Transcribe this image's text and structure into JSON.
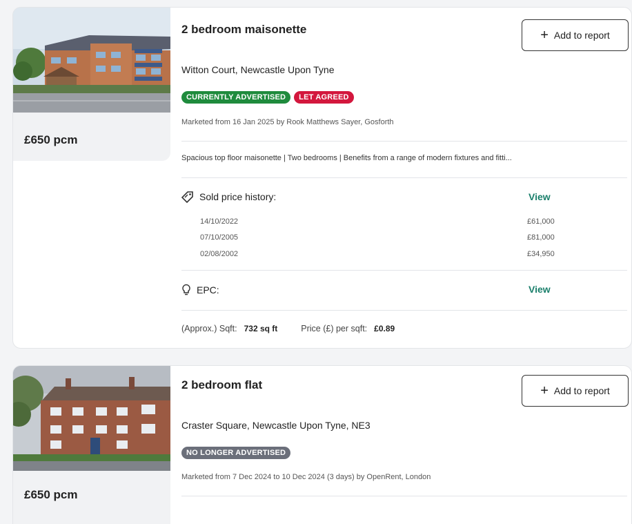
{
  "listings": [
    {
      "title": "2 bedroom maisonette",
      "address": "Witton Court, Newcastle Upon Tyne",
      "price": "£650 pcm",
      "add_button": "Add to report",
      "badges": [
        "CURRENTLY ADVERTISED",
        "LET AGREED"
      ],
      "marketed": "Marketed from 16 Jan 2025 by Rook Matthews Sayer, Gosforth",
      "description": "Spacious top floor maisonette | Two bedrooms | Benefits from a range of modern fixtures and fitti...",
      "sold_history": {
        "label": "Sold price history:",
        "view": "View",
        "entries": [
          {
            "date": "14/10/2022",
            "price": "£61,000"
          },
          {
            "date": "07/10/2005",
            "price": "£81,000"
          },
          {
            "date": "02/08/2002",
            "price": "£34,950"
          }
        ]
      },
      "epc": {
        "label": "EPC:",
        "view": "View"
      },
      "sqft": {
        "label": "(Approx.) Sqft:",
        "value": "732 sq ft",
        "price_label": "Price (£) per sqft:",
        "price_value": "£0.89"
      }
    },
    {
      "title": "2 bedroom flat",
      "address": "Craster Square, Newcastle Upon Tyne, NE3",
      "price": "£650 pcm",
      "add_button": "Add to report",
      "badges": [
        "NO LONGER ADVERTISED"
      ],
      "marketed": "Marketed from 7 Dec 2024 to 10 Dec 2024 (3 days) by OpenRent, London"
    }
  ],
  "colors": {
    "green_badge": "#1f8b3d",
    "red_badge": "#d3173d",
    "grey_badge": "#6b6f7a",
    "link": "#1a7f6b"
  },
  "icons": {
    "add": "plus-icon",
    "sold_history": "tag-icon",
    "epc": "lightbulb-icon"
  }
}
